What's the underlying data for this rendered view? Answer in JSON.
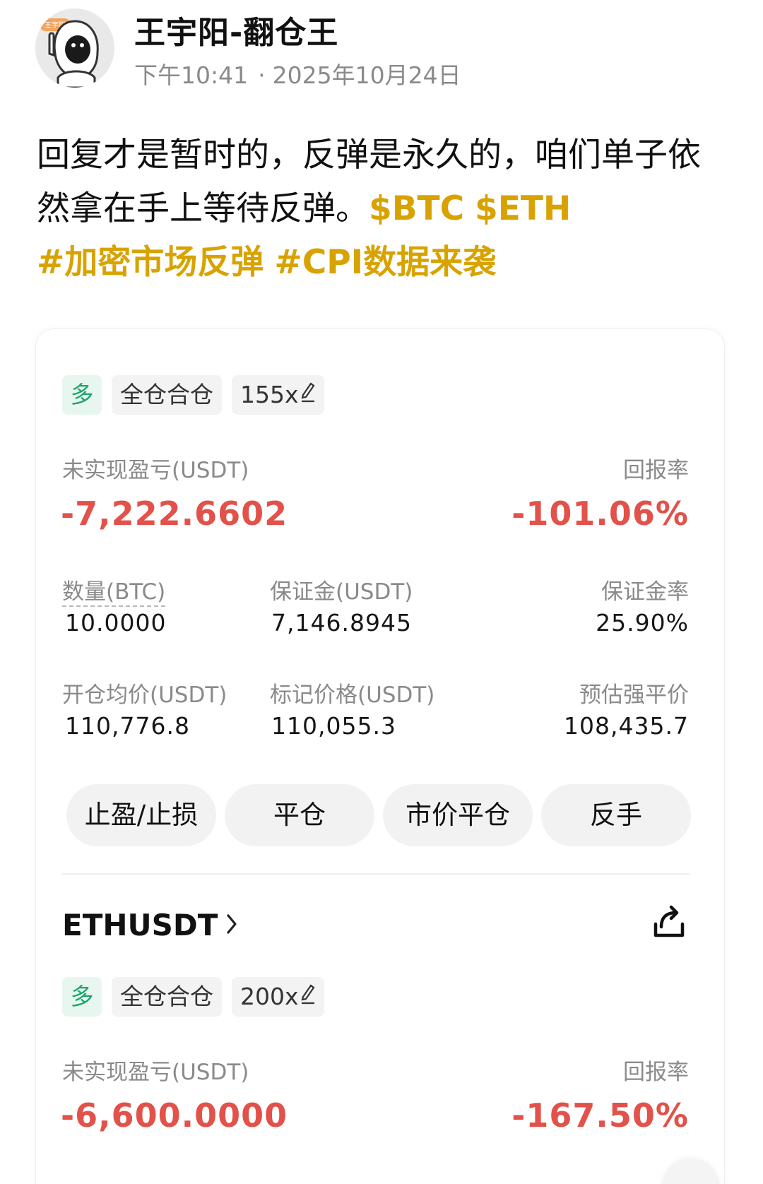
{
  "author": {
    "name": "王宇阳-翻仓王",
    "avatar_badge": "王宇阳",
    "time": "下午10:41",
    "date": "2025年10月24日"
  },
  "post": {
    "text": "回复才是暂时的，反弹是永久的，咱们单子依然拿在手上等待反弹。",
    "cashtags": [
      "$BTC",
      "$ETH"
    ],
    "hashtags": [
      "#加密市场反弹",
      "#CPI数据来袭"
    ]
  },
  "colors": {
    "accent_tag": "#d8a300",
    "negative": "#e2514a",
    "long": "#1fa56d"
  },
  "positions": [
    {
      "side": "多",
      "margin_mode": "全仓合仓",
      "leverage": "155x",
      "pnl_label": "未实现盈亏(USDT)",
      "pnl": "-7,222.6602",
      "roe_label": "回报率",
      "roe": "-101.06%",
      "qty_label": "数量(BTC)",
      "qty": "10.0000",
      "margin_label": "保证金(USDT)",
      "margin": "7,146.8945",
      "margin_ratio_label": "保证金率",
      "margin_ratio": "25.90%",
      "entry_label": "开仓均价(USDT)",
      "entry": "110,776.8",
      "mark_label": "标记价格(USDT)",
      "mark": "110,055.3",
      "liq_label": "预估强平价",
      "liq": "108,435.7"
    },
    {
      "symbol": "ETHUSDT",
      "side": "多",
      "margin_mode": "全仓合仓",
      "leverage": "200x",
      "pnl_label": "未实现盈亏(USDT)",
      "pnl": "-6,600.0000",
      "roe_label": "回报率",
      "roe": "-167.50%"
    }
  ],
  "actions": {
    "tpsl": "止盈/止损",
    "close": "平仓",
    "market_close": "市价平仓",
    "reverse": "反手"
  },
  "icons": [
    "edit-icon",
    "chevron-right-icon",
    "share-icon"
  ]
}
